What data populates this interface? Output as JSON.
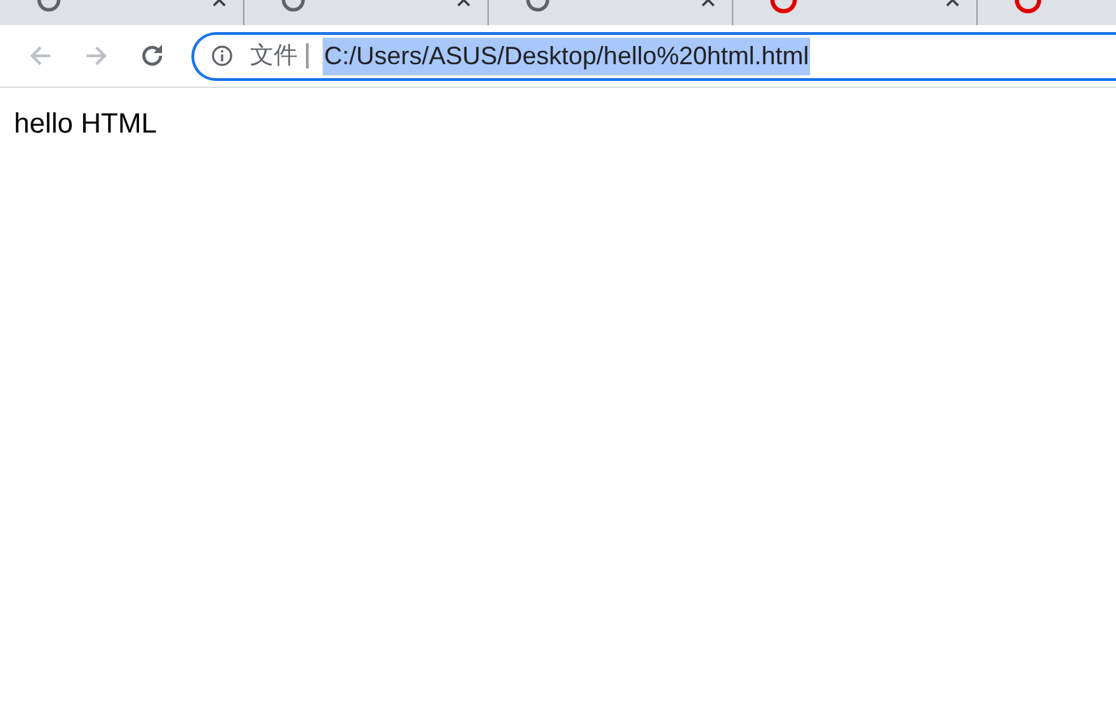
{
  "tabs": [
    {
      "kind": "page"
    },
    {
      "kind": "page"
    },
    {
      "kind": "page"
    },
    {
      "kind": "site"
    },
    {
      "kind": "site"
    }
  ],
  "nav_buttons": [
    {
      "kind": "back",
      "disabled": true
    },
    {
      "kind": "forward",
      "disabled": true
    },
    {
      "kind": "reload",
      "disabled": false
    }
  ],
  "address_bar": {
    "security_label": "文件",
    "url": "C:/Users/ASUS/Desktop/hello%20html.html",
    "url_selected": true
  },
  "page": {
    "text": "hello HTML"
  }
}
